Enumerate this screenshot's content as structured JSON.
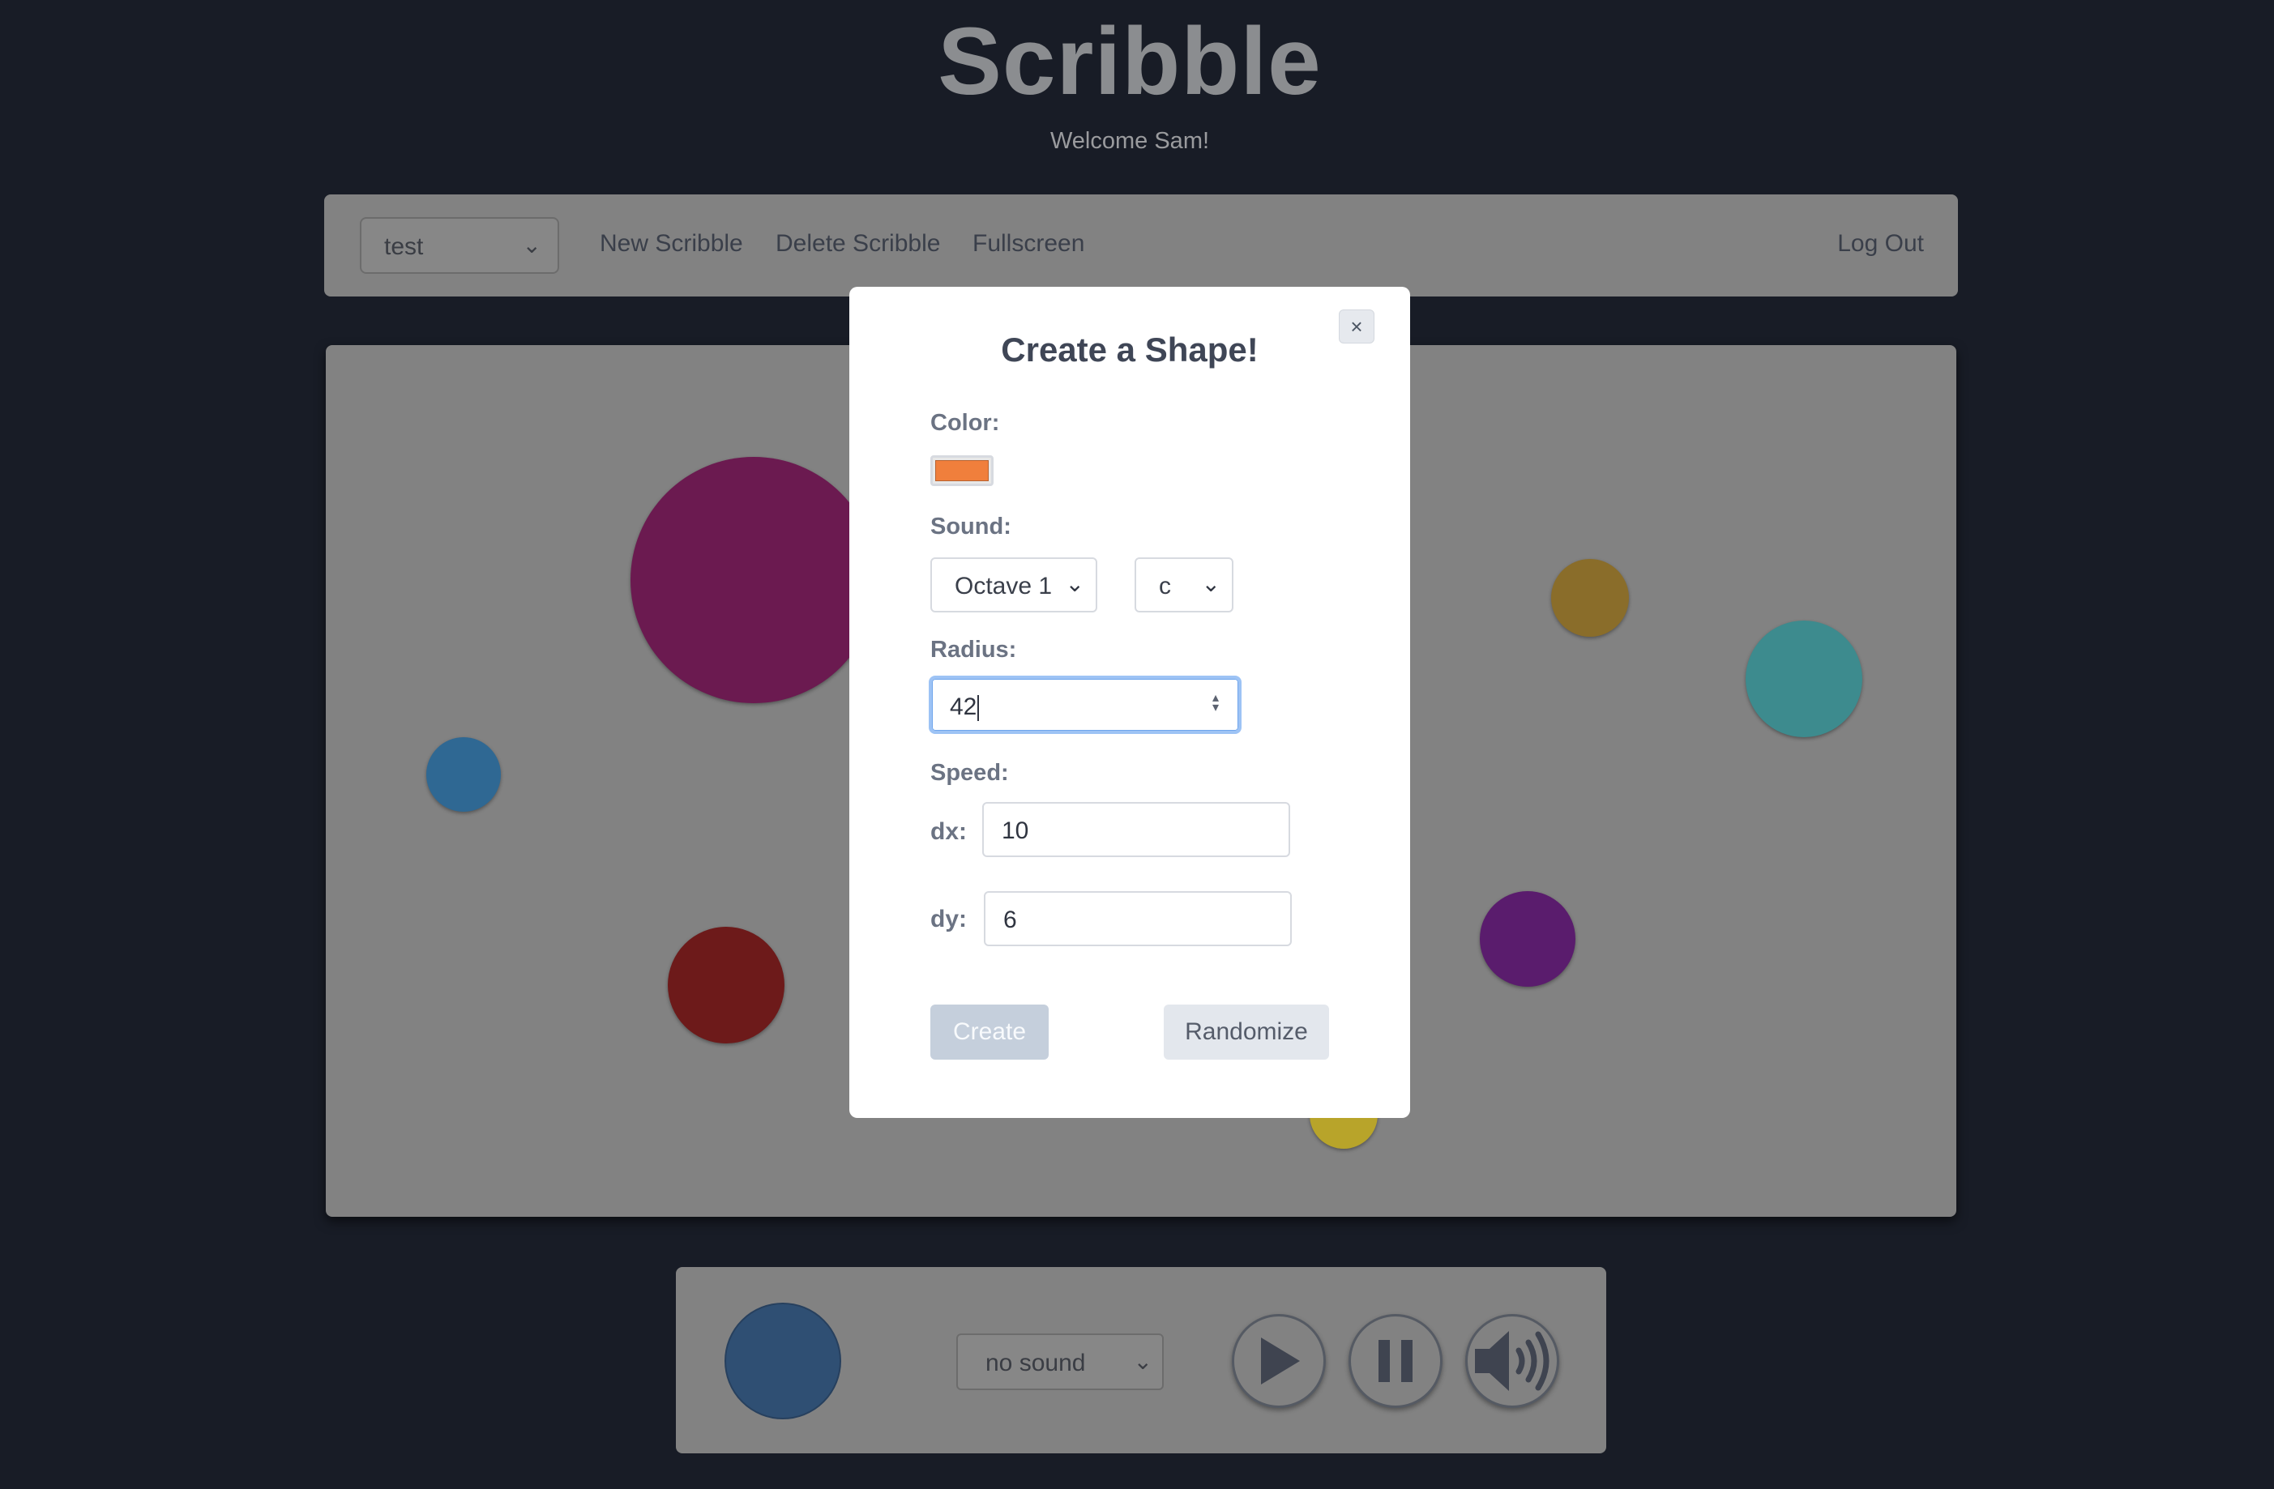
{
  "app": {
    "title": "Scribble",
    "welcome": "Welcome Sam!"
  },
  "navbar": {
    "scribble_select": "test",
    "new_label": "New Scribble",
    "delete_label": "Delete Scribble",
    "fullscreen_label": "Fullscreen",
    "logout_label": "Log Out"
  },
  "canvas": {
    "shapes": [
      {
        "color": "#6b1a50"
      },
      {
        "color": "#2f6893"
      },
      {
        "color": "#6d1a1a"
      },
      {
        "color": "#8a6d2a"
      },
      {
        "color": "#3d8b8e"
      },
      {
        "color": "#5a1c6d"
      },
      {
        "color": "#b8a42a"
      }
    ]
  },
  "player": {
    "sound_select": "no sound",
    "preview_color": "#2f4f73",
    "play_icon": "play-icon",
    "pause_icon": "pause-icon",
    "volume_icon": "volume-icon"
  },
  "modal": {
    "title": "Create a Shape!",
    "close_label": "×",
    "color_label": "Color:",
    "color_value": "#f07f3c",
    "sound_label": "Sound:",
    "octave_value": "Octave 1",
    "note_value": "c",
    "radius_label": "Radius:",
    "radius_value": "42",
    "speed_label": "Speed:",
    "dx_label": "dx:",
    "dx_value": "10",
    "dy_label": "dy:",
    "dy_value": "6",
    "create_label": "Create",
    "randomize_label": "Randomize"
  }
}
